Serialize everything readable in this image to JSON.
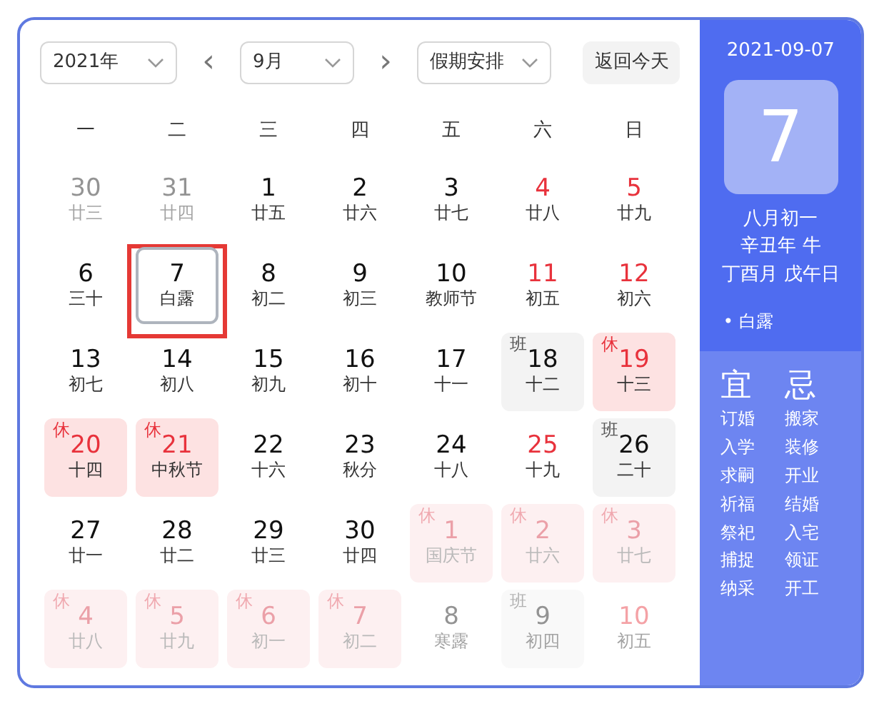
{
  "toolbar": {
    "year": "2021年",
    "prev": "‹",
    "month": "9月",
    "next": "›",
    "holiday": "假期安排",
    "today_button": "返回今天"
  },
  "weekdays": [
    "一",
    "二",
    "三",
    "四",
    "五",
    "六",
    "日"
  ],
  "days": [
    {
      "day": "30",
      "lunar": "廿三",
      "in_month": false,
      "red": false,
      "selected": false
    },
    {
      "day": "31",
      "lunar": "廿四",
      "in_month": false,
      "red": false,
      "selected": false
    },
    {
      "day": "1",
      "lunar": "廿五",
      "in_month": true,
      "red": false,
      "selected": false
    },
    {
      "day": "2",
      "lunar": "廿六",
      "in_month": true,
      "red": false,
      "selected": false
    },
    {
      "day": "3",
      "lunar": "廿七",
      "in_month": true,
      "red": false,
      "selected": false
    },
    {
      "day": "4",
      "lunar": "廿八",
      "in_month": true,
      "red": true,
      "selected": false
    },
    {
      "day": "5",
      "lunar": "廿九",
      "in_month": true,
      "red": true,
      "selected": false
    },
    {
      "day": "6",
      "lunar": "三十",
      "in_month": true,
      "red": false,
      "selected": false
    },
    {
      "day": "7",
      "lunar": "白露",
      "in_month": true,
      "red": false,
      "selected": true
    },
    {
      "day": "8",
      "lunar": "初二",
      "in_month": true,
      "red": false,
      "selected": false
    },
    {
      "day": "9",
      "lunar": "初三",
      "in_month": true,
      "red": false,
      "selected": false
    },
    {
      "day": "10",
      "lunar": "教师节",
      "in_month": true,
      "red": false,
      "selected": false
    },
    {
      "day": "11",
      "lunar": "初五",
      "in_month": true,
      "red": true,
      "selected": false
    },
    {
      "day": "12",
      "lunar": "初六",
      "in_month": true,
      "red": true,
      "selected": false
    },
    {
      "day": "13",
      "lunar": "初七",
      "in_month": true,
      "red": false,
      "selected": false
    },
    {
      "day": "14",
      "lunar": "初八",
      "in_month": true,
      "red": false,
      "selected": false
    },
    {
      "day": "15",
      "lunar": "初九",
      "in_month": true,
      "red": false,
      "selected": false
    },
    {
      "day": "16",
      "lunar": "初十",
      "in_month": true,
      "red": false,
      "selected": false
    },
    {
      "day": "17",
      "lunar": "十一",
      "in_month": true,
      "red": false,
      "selected": false
    },
    {
      "day": "18",
      "lunar": "十二",
      "in_month": true,
      "red": false,
      "tag": {
        "kind": "work",
        "text": "班"
      },
      "selected": false
    },
    {
      "day": "19",
      "lunar": "十三",
      "in_month": true,
      "red": true,
      "tag": {
        "kind": "rest",
        "text": "休"
      },
      "selected": false
    },
    {
      "day": "20",
      "lunar": "十四",
      "in_month": true,
      "red": true,
      "tag": {
        "kind": "rest",
        "text": "休"
      },
      "selected": false
    },
    {
      "day": "21",
      "lunar": "中秋节",
      "in_month": true,
      "red": true,
      "tag": {
        "kind": "rest",
        "text": "休"
      },
      "selected": false
    },
    {
      "day": "22",
      "lunar": "十六",
      "in_month": true,
      "red": false,
      "selected": false
    },
    {
      "day": "23",
      "lunar": "秋分",
      "in_month": true,
      "red": false,
      "selected": false
    },
    {
      "day": "24",
      "lunar": "十八",
      "in_month": true,
      "red": false,
      "selected": false
    },
    {
      "day": "25",
      "lunar": "十九",
      "in_month": true,
      "red": true,
      "selected": false
    },
    {
      "day": "26",
      "lunar": "二十",
      "in_month": true,
      "red": false,
      "tag": {
        "kind": "work",
        "text": "班"
      },
      "selected": false
    },
    {
      "day": "27",
      "lunar": "廿一",
      "in_month": true,
      "red": false,
      "selected": false
    },
    {
      "day": "28",
      "lunar": "廿二",
      "in_month": true,
      "red": false,
      "selected": false
    },
    {
      "day": "29",
      "lunar": "廿三",
      "in_month": true,
      "red": false,
      "selected": false
    },
    {
      "day": "30",
      "lunar": "廿四",
      "in_month": true,
      "red": false,
      "selected": false
    },
    {
      "day": "1",
      "lunar": "国庆节",
      "in_month": false,
      "red": true,
      "tag": {
        "kind": "rest",
        "text": "休"
      },
      "selected": false
    },
    {
      "day": "2",
      "lunar": "廿六",
      "in_month": false,
      "red": true,
      "tag": {
        "kind": "rest",
        "text": "休"
      },
      "selected": false
    },
    {
      "day": "3",
      "lunar": "廿七",
      "in_month": false,
      "red": true,
      "tag": {
        "kind": "rest",
        "text": "休"
      },
      "selected": false
    },
    {
      "day": "4",
      "lunar": "廿八",
      "in_month": false,
      "red": true,
      "tag": {
        "kind": "rest",
        "text": "休"
      },
      "selected": false
    },
    {
      "day": "5",
      "lunar": "廿九",
      "in_month": false,
      "red": true,
      "tag": {
        "kind": "rest",
        "text": "休"
      },
      "selected": false
    },
    {
      "day": "6",
      "lunar": "初一",
      "in_month": false,
      "red": true,
      "tag": {
        "kind": "rest",
        "text": "休"
      },
      "selected": false
    },
    {
      "day": "7",
      "lunar": "初二",
      "in_month": false,
      "red": true,
      "tag": {
        "kind": "rest",
        "text": "休"
      },
      "selected": false
    },
    {
      "day": "8",
      "lunar": "寒露",
      "in_month": false,
      "red": false,
      "selected": false
    },
    {
      "day": "9",
      "lunar": "初四",
      "in_month": false,
      "red": false,
      "tag": {
        "kind": "work",
        "text": "班"
      },
      "selected": false
    },
    {
      "day": "10",
      "lunar": "初五",
      "in_month": false,
      "red": true,
      "selected": false
    }
  ],
  "side": {
    "date": "2021-09-07",
    "big_day": "7",
    "lunar_lines": [
      "八月初一",
      "辛丑年 牛",
      "丁酉月 戊午日"
    ],
    "term": "• 白露",
    "yi_title": "宜",
    "ji_title": "忌",
    "yi": [
      "订婚",
      "入学",
      "求嗣",
      "祈福",
      "祭祀",
      "捕捉",
      "纳采"
    ],
    "ji": [
      "搬家",
      "装修",
      "开业",
      "结婚",
      "入宅",
      "领证",
      "开工"
    ]
  }
}
